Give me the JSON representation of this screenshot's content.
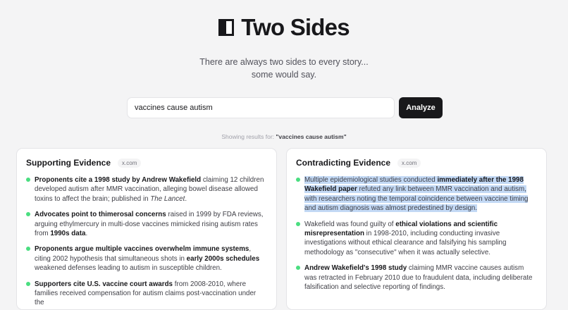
{
  "app": {
    "title": "Two Sides",
    "tagline_line1": "There are always two sides to every story...",
    "tagline_line2": "some would say."
  },
  "search": {
    "value": "vaccines cause autism",
    "button_label": "Analyze"
  },
  "results": {
    "prefix": "Showing results for:",
    "query": "\"vaccines cause autism\""
  },
  "supporting": {
    "title": "Supporting Evidence",
    "source": "x.com",
    "items": [
      {
        "lead": "Proponents cite a 1998 study by Andrew Wakefield",
        "text": " claiming 12 children developed autism after MMR vaccination, alleging bowel disease allowed toxins to affect the brain; published in ",
        "italic": "The Lancet",
        "tail": "."
      },
      {
        "lead": "Advocates point to thimerosal concerns",
        "text": " raised in 1999 by FDA reviews, arguing ethylmercury in multi-dose vaccines mimicked rising autism rates from ",
        "bold2": "1990s data",
        "tail": "."
      },
      {
        "lead": "Proponents argue multiple vaccines overwhelm immune systems",
        "text": ", citing 2002 hypothesis that simultaneous shots in ",
        "bold2": "early 2000s schedules",
        "tail": " weakened defenses leading to autism in susceptible children."
      },
      {
        "lead": "Supporters cite U.S. vaccine court awards",
        "text": " from 2008-2010, where families received compensation for autism claims post-vaccination under the"
      }
    ]
  },
  "contradicting": {
    "title": "Contradicting Evidence",
    "source": "x.com",
    "items": [
      {
        "pre": "Multiple epidemiological studies conducted ",
        "bold": "immediately after the 1998 Wakefield paper",
        "text": " refuted any link between MMR vaccination and autism, with researchers noting the temporal coincidence between vaccine timing and autism diagnosis was almost predestined by design."
      },
      {
        "pre": "Wakefield was found guilty of ",
        "bold": "ethical violations and scientific misrepresentation",
        "text": " in 1998-2010, including conducting invasive investigations without ethical clearance and falsifying his sampling methodology as \"consecutive\" when it was actually selective."
      },
      {
        "pre": "",
        "bold": "Andrew Wakefield's 1998 study",
        "text": " claiming MMR vaccine causes autism was retracted in February 2010 due to fraudulent data, including deliberate falsification and selective reporting of findings."
      }
    ]
  },
  "colors": {
    "accent": "#18181b",
    "bullet": "#4ade80",
    "highlight": "#c3d9f5"
  }
}
